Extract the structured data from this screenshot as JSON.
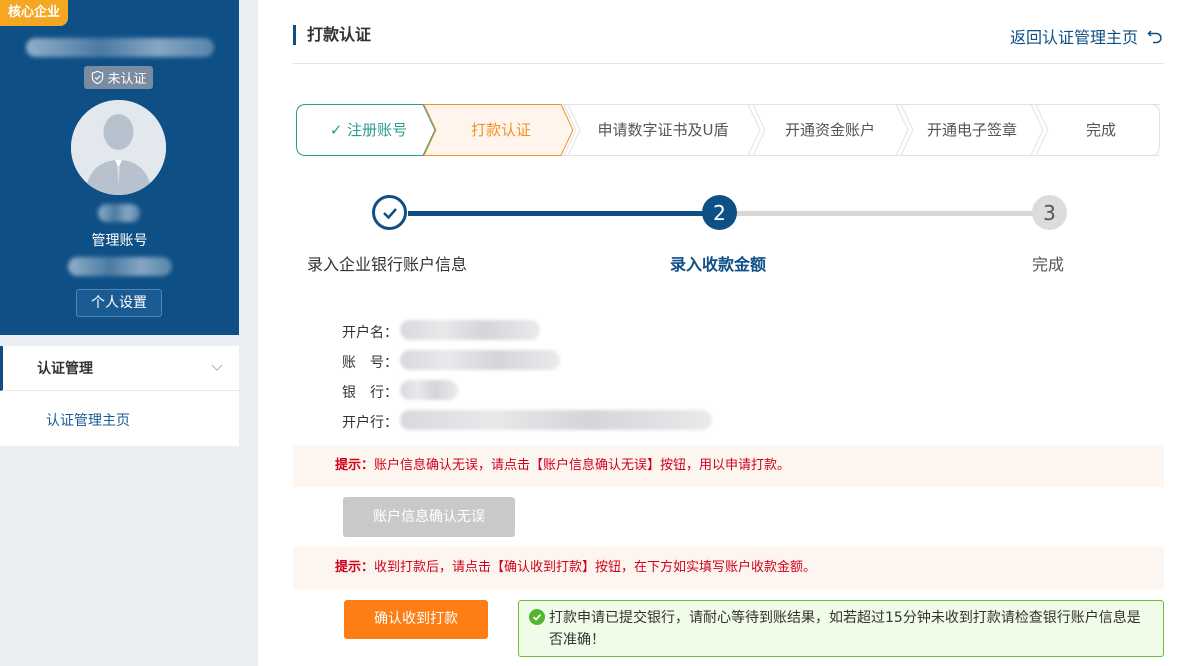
{
  "sidebar": {
    "badge": "核心企业",
    "status": "未认证",
    "account_label": "管理账号",
    "settings_button": "个人设置",
    "nav_title": "认证管理",
    "nav_item": "认证管理主页"
  },
  "header": {
    "title": "打款认证",
    "back_link": "返回认证管理主页"
  },
  "steps": [
    {
      "label": "✓ 注册账号",
      "state": "done"
    },
    {
      "label": "打款认证",
      "state": "active"
    },
    {
      "label": "申请数字证书及U盾",
      "state": "pending"
    },
    {
      "label": "开通资金账户",
      "state": "pending"
    },
    {
      "label": "开通电子签章",
      "state": "pending"
    },
    {
      "label": "完成",
      "state": "pending"
    }
  ],
  "progress": {
    "step1_label": "录入企业银行账户信息",
    "step2_number": "2",
    "step2_label": "录入收款金额",
    "step3_number": "3",
    "step3_label": "完成"
  },
  "account_info": {
    "name_label": "开户名：",
    "number_label": "账　号：",
    "bank_label": "银　行：",
    "branch_label": "开户行："
  },
  "tip1": {
    "prefix": "提示：",
    "text": "账户信息确认无误，请点击【账户信息确认无误】按钮，用以申请打款。"
  },
  "confirm_info_button": "账户信息确认无误",
  "tip2": {
    "prefix": "提示：",
    "text": "收到打款后，请点击【确认收到打款】按钮，在下方如实填写账户收款金额。"
  },
  "confirm_received_button": "确认收到打款",
  "success_message": "打款申请已提交银行，请耐心等待到账结果，如若超过15分钟未收到打款请检查银行账户信息是否准确！",
  "colors": {
    "primary": "#0e4f86",
    "accent": "#fd7e14",
    "done": "#2a9d8f",
    "active": "#f0932b",
    "tip_red": "#d0021b",
    "success_green": "#6abf40"
  }
}
